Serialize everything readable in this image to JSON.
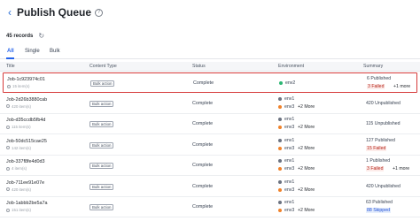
{
  "header": {
    "back_icon": "‹",
    "title": "Publish Queue",
    "help_icon": "?"
  },
  "records": {
    "count_label": "45 records",
    "refresh_icon": "↻"
  },
  "tabs": [
    {
      "label": "All"
    },
    {
      "label": "Single"
    },
    {
      "label": "Bulk"
    }
  ],
  "columns": {
    "title": "Title",
    "content_type": "Content Type",
    "status": "Status",
    "environment": "Environment",
    "summary": "Summary"
  },
  "colors": {
    "env2": "#2bb673",
    "env1": "#6b7280",
    "env3": "#f0822b",
    "accent": "#2563eb",
    "highlight": "#d63b3b"
  },
  "rows": [
    {
      "job": "Job-1c923974c01",
      "items": "15 item(s)",
      "type": "Bulk action",
      "status": "Complete",
      "envs": [
        {
          "name": "env2"
        }
      ],
      "env_more": "",
      "summary": [
        {
          "text": "6 Published",
          "style": "plain"
        },
        {
          "text": "3 Failed",
          "style": "red"
        }
      ],
      "summary_more": "+1 more"
    },
    {
      "job": "Job-2d26b3880cab",
      "items": "420 item(s)",
      "type": "Bulk action",
      "status": "Complete",
      "envs": [
        {
          "name": "env1"
        },
        {
          "name": "env3"
        }
      ],
      "env_more": "+2 More",
      "summary": [
        {
          "text": "420 Unpublished",
          "style": "plain"
        }
      ],
      "summary_more": ""
    },
    {
      "job": "Job-d35ccdb5fb4d",
      "items": "115 item(s)",
      "type": "Bulk action",
      "status": "Complete",
      "envs": [
        {
          "name": "env1"
        },
        {
          "name": "env3"
        }
      ],
      "env_more": "+2 More",
      "summary": [
        {
          "text": "115 Unpublished",
          "style": "plain"
        }
      ],
      "summary_more": ""
    },
    {
      "job": "Job-50dc515cae25",
      "items": "142 item(s)",
      "type": "Bulk action",
      "status": "Complete",
      "envs": [
        {
          "name": "env1"
        },
        {
          "name": "env3"
        }
      ],
      "env_more": "+2 More",
      "summary": [
        {
          "text": "127 Published",
          "style": "plain"
        },
        {
          "text": "15 Failed",
          "style": "red"
        }
      ],
      "summary_more": ""
    },
    {
      "job": "Job-337f8fe4d0d3",
      "items": "4 item(s)",
      "type": "Bulk action",
      "status": "Complete",
      "envs": [
        {
          "name": "env1"
        },
        {
          "name": "env3"
        }
      ],
      "env_more": "+2 More",
      "summary": [
        {
          "text": "1 Published",
          "style": "plain"
        },
        {
          "text": "3 Failed",
          "style": "red"
        }
      ],
      "summary_more": "+1 more"
    },
    {
      "job": "Job-711ee91e07e",
      "items": "420 item(s)",
      "type": "Bulk action",
      "status": "Complete",
      "envs": [
        {
          "name": "env1"
        },
        {
          "name": "env3"
        }
      ],
      "env_more": "+2 More",
      "summary": [
        {
          "text": "420 Unpublished",
          "style": "plain"
        }
      ],
      "summary_more": ""
    },
    {
      "job": "Job-1abbb2be5a7a",
      "items": "151 item(s)",
      "type": "Bulk action",
      "status": "Complete",
      "envs": [
        {
          "name": "env1"
        },
        {
          "name": "env3"
        }
      ],
      "env_more": "+2 More",
      "summary": [
        {
          "text": "63 Published",
          "style": "plain"
        },
        {
          "text": "88 Skipped",
          "style": "blue"
        }
      ],
      "summary_more": ""
    }
  ]
}
